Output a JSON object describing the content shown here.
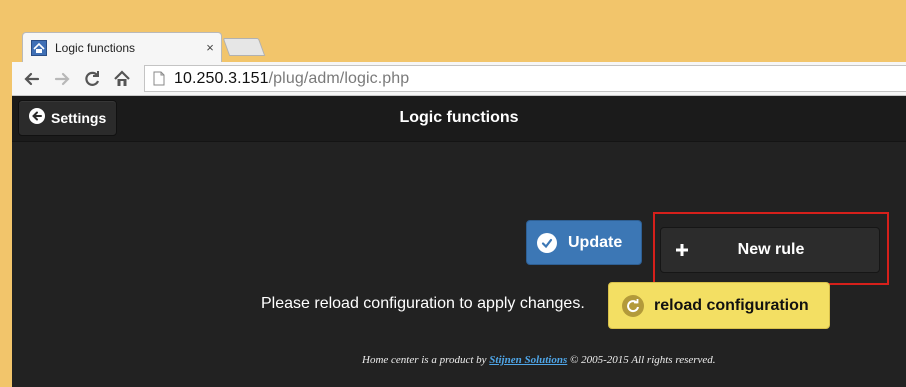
{
  "browser": {
    "tab": {
      "title": "Logic functions",
      "close_glyph": "×"
    },
    "address": {
      "host": "10.250.3.151",
      "path": "/plug/adm/logic.php"
    }
  },
  "header": {
    "back_label": "Settings",
    "title": "Logic functions"
  },
  "actions": {
    "update_label": "Update",
    "new_rule_label": "New rule",
    "reload_notice": "Please reload configuration to apply changes.",
    "reload_label": "reload configuration"
  },
  "footer": {
    "prefix": "Home center is a product by ",
    "link_text": "Stijnen Solutions",
    "suffix": " © 2005-2015 All rights reserved."
  },
  "colors": {
    "update_button": "#3c77b5",
    "reload_button": "#f3df63",
    "highlight_border": "#d6201b",
    "app_background": "#222222"
  },
  "icons": {
    "back": "arrow-left-icon",
    "update": "check-circle-icon",
    "new_rule": "plus-icon",
    "reload": "refresh-icon"
  }
}
